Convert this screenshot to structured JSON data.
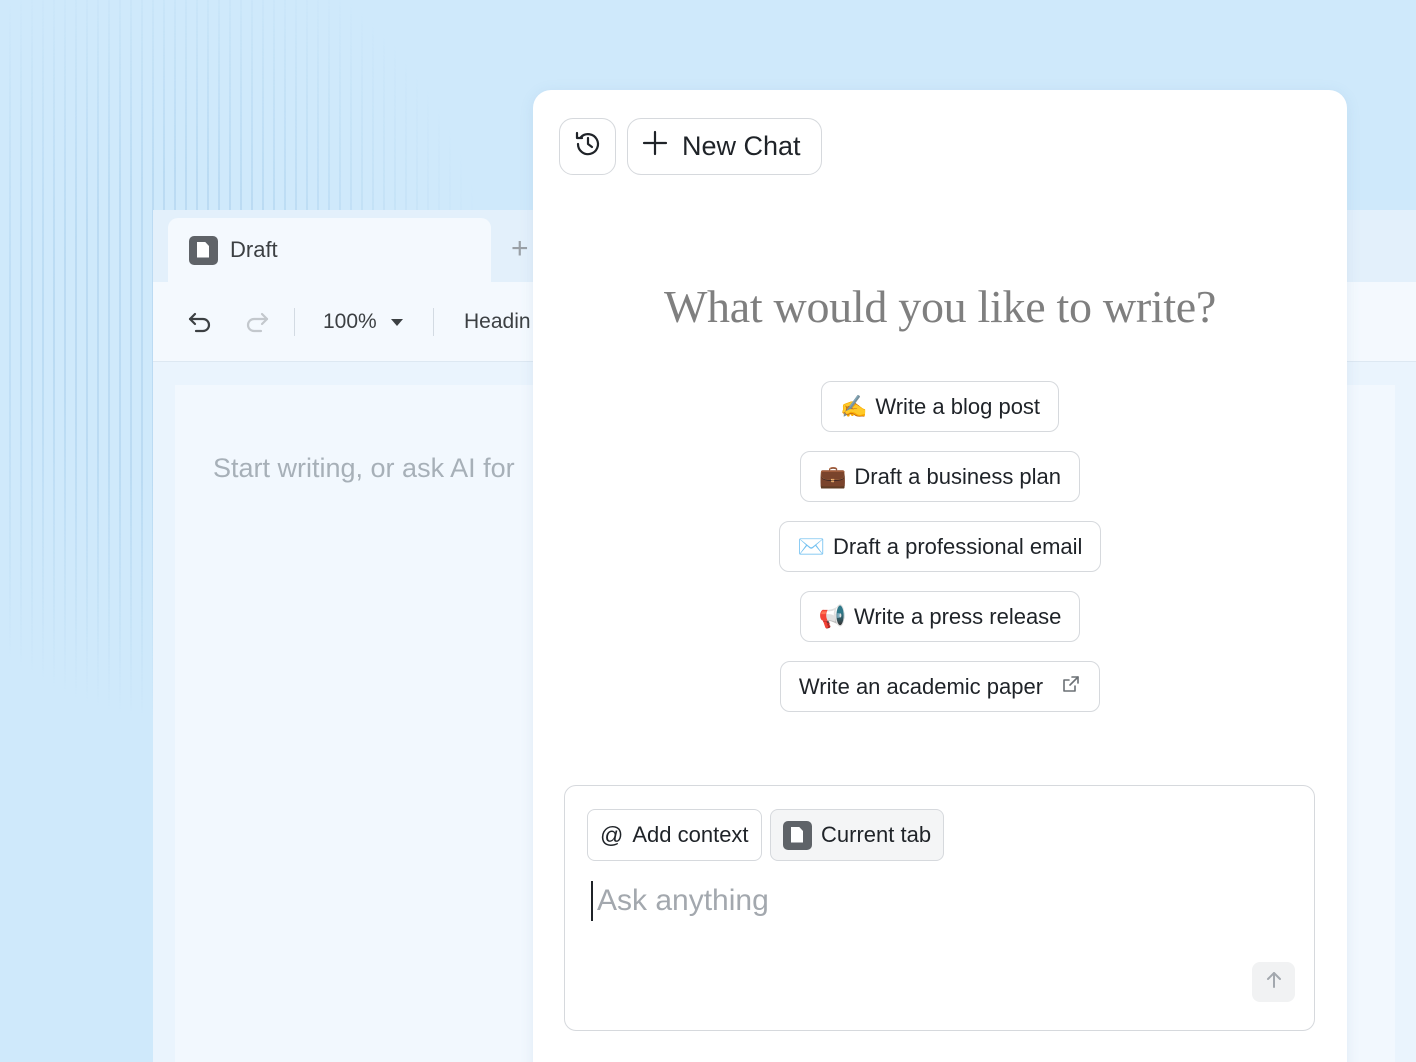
{
  "editor": {
    "tab_label": "Draft",
    "tab_add": "+",
    "zoom": "100%",
    "style": "Headin",
    "placeholder": "Start writing, or ask AI for"
  },
  "chat": {
    "new_chat_label": "New Chat",
    "headline": "What would you like to write?",
    "suggestions": [
      {
        "emoji": "✍️",
        "label": "Write a blog post"
      },
      {
        "emoji": "💼",
        "label": "Draft a business plan"
      },
      {
        "emoji": "✉️",
        "label": "Draft a professional email"
      },
      {
        "emoji": "📢",
        "label": "Write a press release"
      },
      {
        "emoji": "",
        "label": "Write an academic paper"
      }
    ],
    "composer": {
      "add_context_symbol": "@",
      "add_context_label": "Add context",
      "current_tab_label": "Current tab",
      "placeholder": "Ask anything"
    }
  },
  "icons": {
    "history": "history-icon",
    "plus": "plus-icon",
    "external": "external-link-icon",
    "send": "arrow-up-icon",
    "undo": "undo-icon",
    "redo": "redo-icon",
    "document": "document-icon"
  }
}
